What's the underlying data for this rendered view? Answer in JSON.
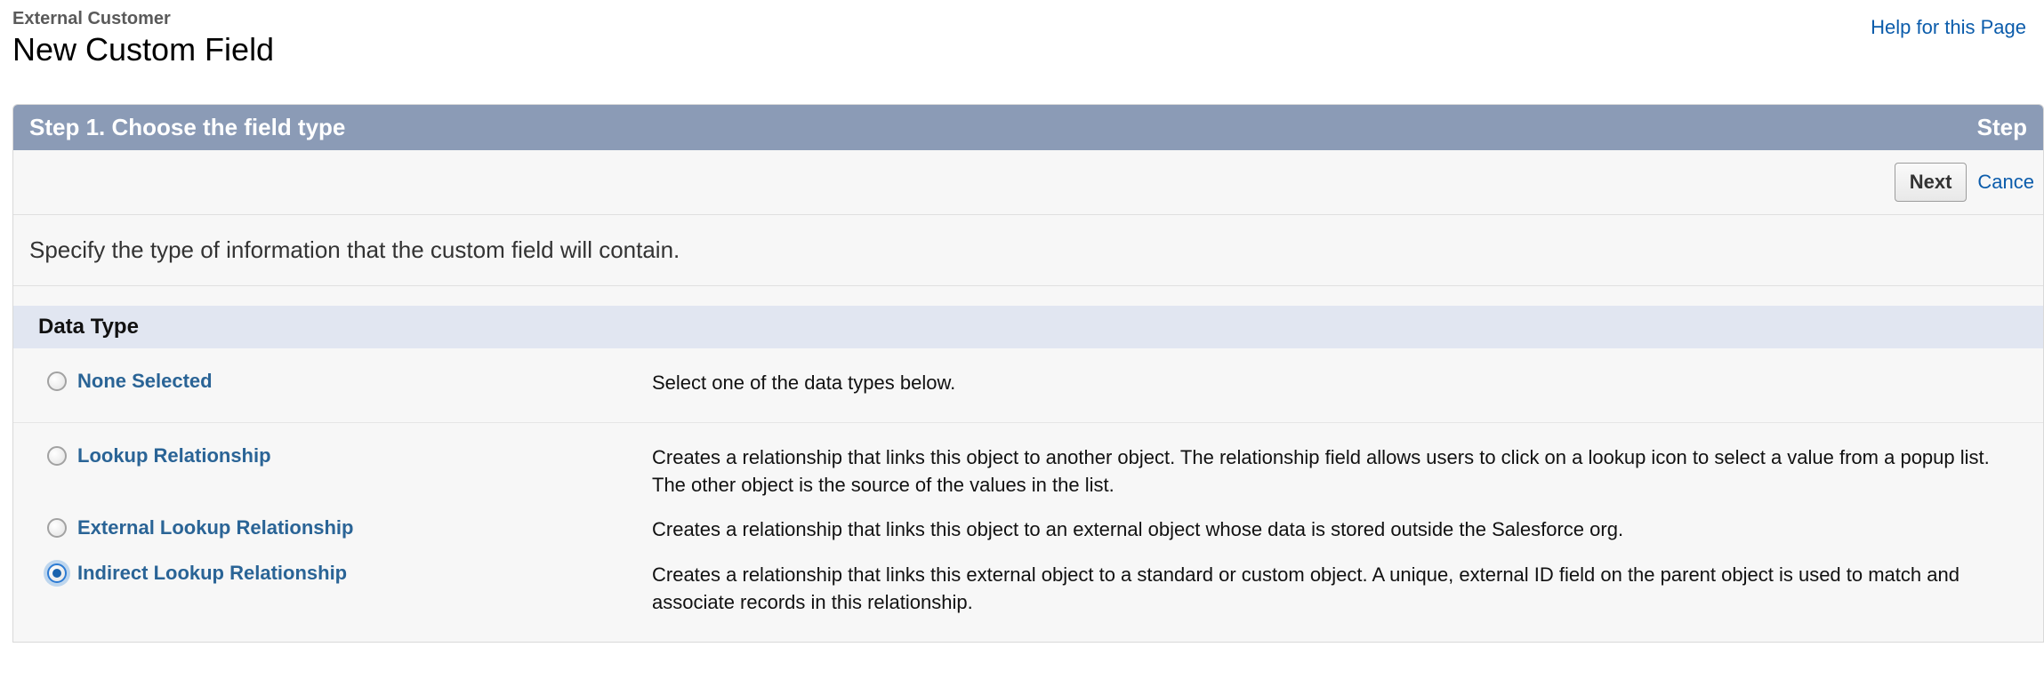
{
  "header": {
    "breadcrumb": "External Customer",
    "title": "New Custom Field",
    "help_link": "Help for this Page"
  },
  "step_bar": {
    "left": "Step 1. Choose the field type",
    "right": "Step"
  },
  "buttons": {
    "next": "Next",
    "cancel": "Cance"
  },
  "instruction": "Specify the type of information that the custom field will contain.",
  "section_title": "Data Type",
  "data_types": {
    "none": {
      "label": "None Selected",
      "desc": "Select one of the data types below.",
      "selected": false
    },
    "lookup": {
      "label": "Lookup Relationship",
      "desc": "Creates a relationship that links this object to another object. The relationship field allows users to click on a lookup icon to select a value from a popup list. The other object is the source of the values in the list.",
      "selected": false
    },
    "external_lookup": {
      "label": "External Lookup Relationship",
      "desc": "Creates a relationship that links this object to an external object whose data is stored outside the Salesforce org.",
      "selected": false
    },
    "indirect_lookup": {
      "label": "Indirect Lookup Relationship",
      "desc": "Creates a relationship that links this external object to a standard or custom object. A unique, external ID field on the parent object is used to match and associate records in this relationship.",
      "selected": true
    }
  }
}
